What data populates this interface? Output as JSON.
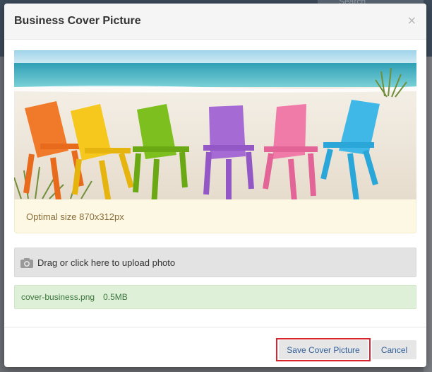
{
  "background": {
    "search_placeholder": "Search"
  },
  "modal": {
    "title": "Business Cover Picture",
    "close_symbol": "×"
  },
  "cover_image": {
    "description_icon": "beach-chairs-photo",
    "chair_colors": [
      "#f07a2a",
      "#f6c71c",
      "#7cbf1e",
      "#a56ad4",
      "#f07aa8",
      "#3fb8e8"
    ]
  },
  "size_hint": "Optimal size 870x312px",
  "dropzone": {
    "icon": "camera-icon",
    "label": "Drag or click here to upload photo"
  },
  "file": {
    "name": "cover-business.png",
    "size": "0.5MB"
  },
  "footer": {
    "save_label": "Save Cover Picture",
    "cancel_label": "Cancel"
  },
  "colors": {
    "highlight": "#d9262c",
    "hint_bg": "#fcf8e3",
    "file_bg": "#dff0d8"
  }
}
